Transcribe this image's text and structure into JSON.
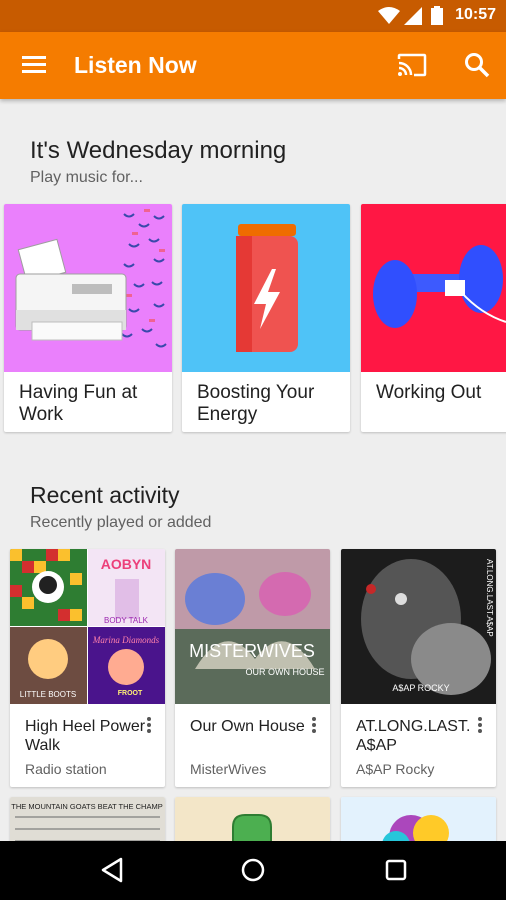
{
  "status_bar": {
    "time": "10:57"
  },
  "app_bar": {
    "title": "Listen Now"
  },
  "greeting": {
    "title": "It's Wednesday morning",
    "subtitle": "Play music for..."
  },
  "moods": [
    {
      "label": "Having Fun at Work",
      "color": "#ea80fc"
    },
    {
      "label": "Boosting Your Energy",
      "color": "#4fc3f7"
    },
    {
      "label": "Working Out",
      "color": "#ff1744"
    }
  ],
  "recent": {
    "title": "Recent activity",
    "subtitle": "Recently played or added",
    "items": [
      {
        "name": "High Heel Power Walk",
        "sub": "Radio station",
        "art_texts": [
          "AOBYN",
          "BODY TALK",
          "LITTLE BOOTS",
          "Marina Diamonds",
          "FROOT"
        ]
      },
      {
        "name": "Our Own House",
        "sub": "MisterWives",
        "art_texts": [
          "MISTERWIVES",
          "OUR OWN HOUSE"
        ]
      },
      {
        "name": "AT.LONG.LAST. A$AP",
        "sub": "A$AP Rocky",
        "art_texts": [
          "AT.LONG.LAST.A$AP",
          "A$AP ROCKY"
        ]
      }
    ]
  },
  "more_rows": {
    "first_art_text": "THE MOUNTAIN GOATS BEAT THE CHAMP"
  }
}
